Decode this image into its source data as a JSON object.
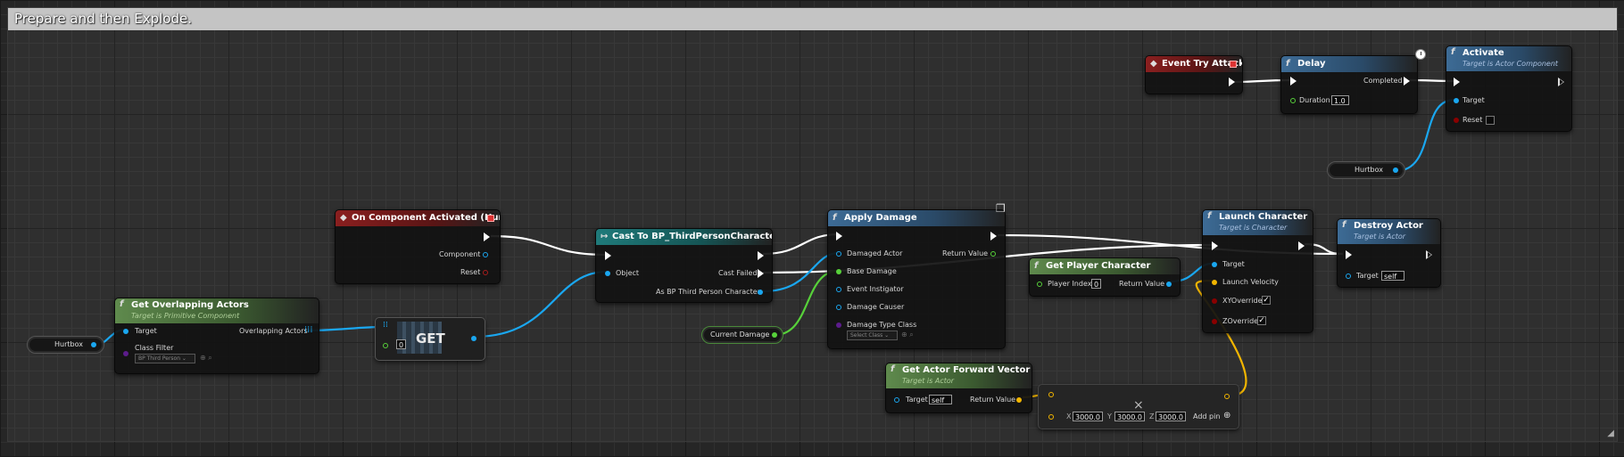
{
  "comment": {
    "title": "Prepare and then Explode."
  },
  "nodes": {
    "event_try_attack": {
      "title": "Event Try Attack"
    },
    "delay": {
      "title": "Delay",
      "completed": "Completed",
      "duration_label": "Duration",
      "duration_value": "1.0"
    },
    "activate": {
      "title": "Activate",
      "subtitle": "Target is Actor Component",
      "target": "Target",
      "reset": "Reset"
    },
    "hurtbox_top": {
      "label": "Hurtbox"
    },
    "on_component_activated": {
      "title": "On Component Activated (Hurtbox)",
      "component": "Component",
      "reset": "Reset"
    },
    "cast": {
      "title": "Cast To BP_ThirdPersonCharacter",
      "object": "Object",
      "cast_failed": "Cast Failed",
      "as_char": "As BP Third Person Character"
    },
    "apply_damage": {
      "title": "Apply Damage",
      "damaged_actor": "Damaged Actor",
      "return_value": "Return Value",
      "base_damage": "Base Damage",
      "event_instigator": "Event Instigator",
      "damage_causer": "Damage Causer",
      "damage_type_class": "Damage Type Class",
      "select_class": "Select Class"
    },
    "get_player_character": {
      "title": "Get Player Character",
      "player_index": "Player Index",
      "player_index_value": "0",
      "return_value": "Return Value"
    },
    "launch_character": {
      "title": "Launch Character",
      "subtitle": "Target is Character",
      "target": "Target",
      "launch_velocity": "Launch Velocity",
      "xy_override": "XYOverride",
      "z_override": "ZOverride"
    },
    "destroy_actor": {
      "title": "Destroy Actor",
      "subtitle": "Target is Actor",
      "target": "Target",
      "target_value": "self"
    },
    "get_overlapping_actors": {
      "title": "Get Overlapping Actors",
      "subtitle": "Target is Primitive Component",
      "target": "Target",
      "overlapping_actors": "Overlapping Actors",
      "class_filter": "Class Filter",
      "class_filter_value": "BP Third Person"
    },
    "hurtbox_left": {
      "label": "Hurtbox"
    },
    "get_array": {
      "label": "GET",
      "index_value": "0"
    },
    "current_damage": {
      "label": "Current Damage"
    },
    "get_actor_forward_vector": {
      "title": "Get Actor Forward Vector",
      "subtitle": "Target is Actor",
      "target": "Target",
      "target_value": "self",
      "return_value": "Return Value"
    },
    "multiply_vector": {
      "x_label": "X",
      "x_value": "3000.0",
      "y_label": "Y",
      "y_value": "3000.0",
      "z_label": "Z",
      "z_value": "3000.0",
      "add_pin": "Add pin",
      "operator": "×"
    }
  },
  "icons": {
    "function": "f",
    "event": "event-diamond-icon",
    "cast": "cast-arrow-icon",
    "checkmark": "✓",
    "clock": "clock-icon",
    "authority": "cube-icon"
  },
  "colors": {
    "exec": "#ffffff",
    "object_pin": "#1aa7f0",
    "float_pin": "#57d13a",
    "vector_pin": "#f2b500",
    "bool_pin": "#8a0000",
    "function_header": "#3d6b95",
    "pure_header": "#5f8a4d",
    "event_header": "#8a1f1f",
    "cast_header": "#1f7a7a"
  }
}
